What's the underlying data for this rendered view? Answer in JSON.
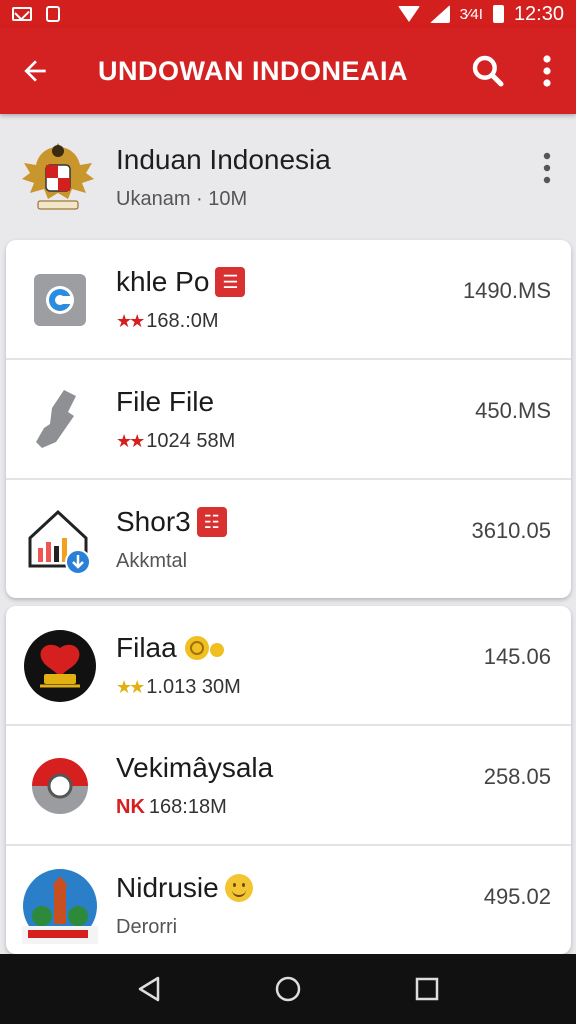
{
  "status_bar": {
    "left_icons": [
      "mail-icon",
      "sim-icon"
    ],
    "right_icons": [
      "wifi-icon",
      "signal-icon",
      "battery-icon"
    ],
    "sim_label": "3⁄4I",
    "time": "12:30"
  },
  "toolbar": {
    "title": "UNDOWAN INDONEAIA",
    "back_icon": "arrow-left-icon",
    "search_icon": "search-icon",
    "more_icon": "more-vert-icon"
  },
  "header": {
    "title": "Induan Indonesia",
    "subtitle": "Ukanam · 10M"
  },
  "items": [
    {
      "title": "khle Po",
      "badge": "☰",
      "sub": "168.:0M",
      "stars": "★★",
      "size": "1490.MS"
    },
    {
      "title": "File File",
      "sub": "1024 58M",
      "stars": "★★",
      "size": "450.MS"
    },
    {
      "title": "Shor3",
      "badge": "☷",
      "sub": "Akkmtal",
      "stars": "",
      "size": "3610.05"
    },
    {
      "title": "Filaa",
      "sub": "1.013 30M",
      "stars": "★★",
      "size": "145.06"
    },
    {
      "title": "Vekimâysala",
      "sub": "168:18M",
      "prefix": "NK",
      "size": "258.05"
    },
    {
      "title": "Nidrusie",
      "sub": "Derorri",
      "size": "495.02"
    }
  ],
  "colors": {
    "accent": "#d42222",
    "star_red": "#d62020",
    "star_gold": "#e2b012"
  }
}
